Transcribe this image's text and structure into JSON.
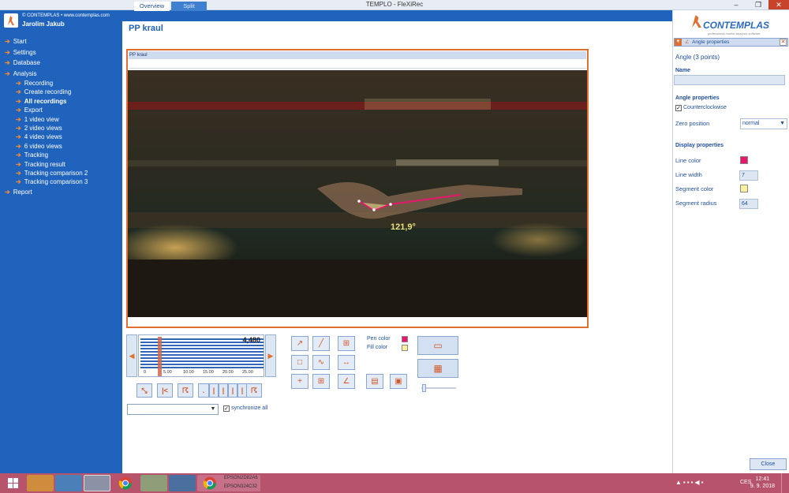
{
  "window": {
    "title": "TEMPLO - FleXiRec",
    "minimize": "–",
    "restore": "❐",
    "close": "✕"
  },
  "sidebar": {
    "company": "© CONTEMPLAS • www.contemplas.com",
    "user": "Jarolim Jakub",
    "items": [
      {
        "label": "Start",
        "level": 0
      },
      {
        "label": "Settings",
        "level": 0
      },
      {
        "label": "Database",
        "level": 0
      },
      {
        "label": "Analysis",
        "level": 0
      },
      {
        "label": "Recording",
        "level": 1
      },
      {
        "label": "Create recording",
        "level": 1
      },
      {
        "label": "All recordings",
        "level": 1,
        "active": true
      },
      {
        "label": "Export",
        "level": 1
      },
      {
        "label": "1 video view",
        "level": 1
      },
      {
        "label": "2 video views",
        "level": 1
      },
      {
        "label": "4 video views",
        "level": 1
      },
      {
        "label": "6 video views",
        "level": 1
      },
      {
        "label": "Tracking",
        "level": 1
      },
      {
        "label": "Tracking result",
        "level": 1
      },
      {
        "label": "Tracking comparison 2",
        "level": 1
      },
      {
        "label": "Tracking comparison 3",
        "level": 1
      },
      {
        "label": "Report",
        "level": 0
      }
    ]
  },
  "tabs": {
    "overview": "Overview",
    "split": "Split"
  },
  "page": {
    "title": "PP kraul"
  },
  "video": {
    "panel_title": "PP kraul",
    "angle_label": "121,9°"
  },
  "timeline": {
    "value": "4,480",
    "ticks": [
      "0",
      "5.00",
      "10.00",
      "15.00",
      "20.00",
      "25.00"
    ]
  },
  "controls": {
    "sync_label": "synchronize all",
    "pen_color_label": "Pen color",
    "fill_color_label": "Fill color"
  },
  "colors": {
    "pen": "#e8176e",
    "fill": "#f7f39a",
    "accent": "#e07030",
    "sidebar": "#1f63bd"
  },
  "right_panel": {
    "brand": "CONTEMPLAS",
    "tagline": "professional motion analysis software",
    "header": "Angle properties",
    "subtitle": "Angle (3 points)",
    "name_label": "Name",
    "name_value": "",
    "angle_props_head": "Angle properties",
    "ccw_label": "Counterclockwise",
    "zero_label": "Zero position",
    "zero_value": "normal",
    "display_head": "Display properties",
    "line_color_label": "Line color",
    "line_width_label": "Line width",
    "line_width_value": "7",
    "segment_color_label": "Segment color",
    "segment_radius_label": "Segment radius",
    "segment_radius_value": "64",
    "close_label": "Close"
  },
  "taskbar": {
    "epson1": "EPSON2D82A6",
    "epson2": "EPSON324C32",
    "lang": "CES",
    "time": "12:41",
    "date": "9. 9. 2018"
  }
}
